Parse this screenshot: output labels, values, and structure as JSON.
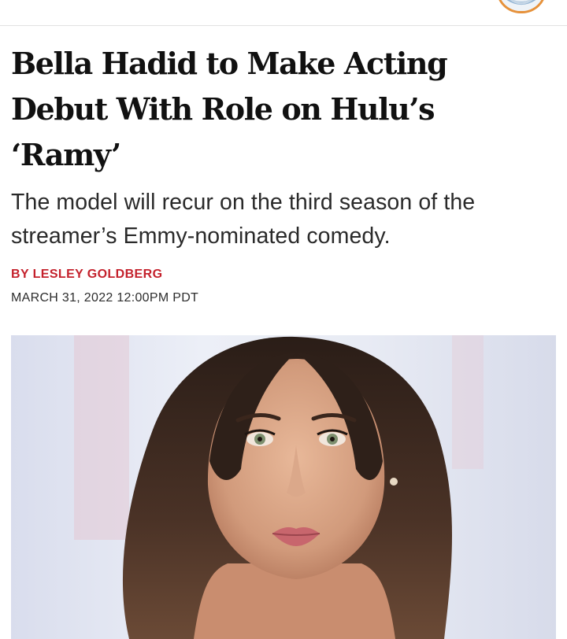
{
  "article": {
    "headline": "Bella Hadid to Make Acting Debut With Role on Hulu’s ‘Ramy’",
    "dek": "The model will recur on the third season of the streamer’s Emmy-nominated comedy.",
    "byline": "BY LESLEY GOLDBERG",
    "dateline": "MARCH 31, 2022 12:00PM PDT"
  },
  "colors": {
    "byline_accent": "#c4212c",
    "headline_text": "#111111",
    "badge_ring": "#e6913a"
  },
  "icons": {
    "top_right_badge": "publication-logo-icon"
  }
}
